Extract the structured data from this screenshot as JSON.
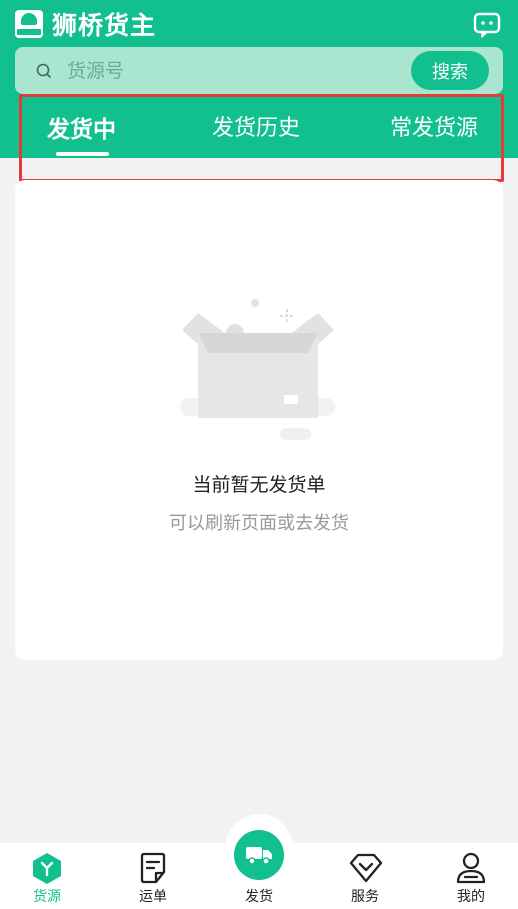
{
  "header": {
    "app_title": "狮桥货主",
    "brand_color": "#12bf8e"
  },
  "search": {
    "placeholder": "货源号",
    "button_label": "搜索"
  },
  "tabs": [
    {
      "label": "发货中",
      "active": true
    },
    {
      "label": "发货历史",
      "active": false
    },
    {
      "label": "常发货源",
      "active": false
    }
  ],
  "empty_state": {
    "title": "当前暂无发货单",
    "subtitle": "可以刷新页面或去发货"
  },
  "bottom_nav": [
    {
      "label": "货源",
      "icon": "cube-icon",
      "active": true
    },
    {
      "label": "运单",
      "icon": "document-icon",
      "active": false
    },
    {
      "label": "发货",
      "icon": "truck-icon",
      "active": false
    },
    {
      "label": "服务",
      "icon": "diamond-icon",
      "active": false
    },
    {
      "label": "我的",
      "icon": "person-icon",
      "active": false
    }
  ],
  "highlight_color": "#e53a3a"
}
